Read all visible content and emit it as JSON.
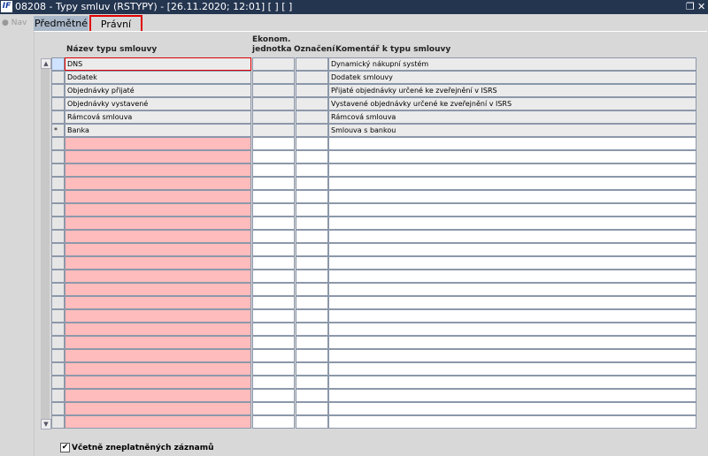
{
  "window": {
    "title": "08208 - Typy smluv (RSTYPY) - [26.11.2020; 12:01]  [ ]  [ ]",
    "logo": "IF",
    "restore_icon": "restore-icon",
    "close_icon": "close-icon"
  },
  "nav": {
    "label": "Nav"
  },
  "tabs": [
    {
      "label": "Předmětné",
      "active": false
    },
    {
      "label": "Právní",
      "active": true,
      "highlighted": true
    }
  ],
  "columns": {
    "name": "Název typu smlouvy",
    "ekonom": "Ekonom. jednotka",
    "oznaceni": "Označení",
    "komentar": "Komentář k typu smlouvy"
  },
  "rows": [
    {
      "indicator": "",
      "name": "DNS",
      "ekonom": "",
      "oznaceni": "",
      "komentar": "Dynamický nákupní systém",
      "focused": true
    },
    {
      "indicator": "",
      "name": "Dodatek",
      "ekonom": "",
      "oznaceni": "",
      "komentar": "Dodatek smlouvy"
    },
    {
      "indicator": "",
      "name": "Objednávky přijaté",
      "ekonom": "",
      "oznaceni": "",
      "komentar": "Přijaté objednávky určené ke zveřejnění v ISRS"
    },
    {
      "indicator": "",
      "name": "Objednávky vystavené",
      "ekonom": "",
      "oznaceni": "",
      "komentar": "Vystavené objednávky určené ke zveřejnění v ISRS"
    },
    {
      "indicator": "",
      "name": "Rámcová smlouva",
      "ekonom": "",
      "oznaceni": "",
      "komentar": "Rámcová smlouva"
    },
    {
      "indicator": "*",
      "name": "Banka",
      "ekonom": "",
      "oznaceni": "",
      "komentar": "Smlouva s bankou"
    }
  ],
  "empty_row_count": 22,
  "colors": {
    "required_empty": "#ffbcbc",
    "titlebar": "#243550",
    "focus": "#e00000"
  },
  "checkbox": {
    "label": "Včetně zneplatněných záznamů",
    "checked": true
  }
}
